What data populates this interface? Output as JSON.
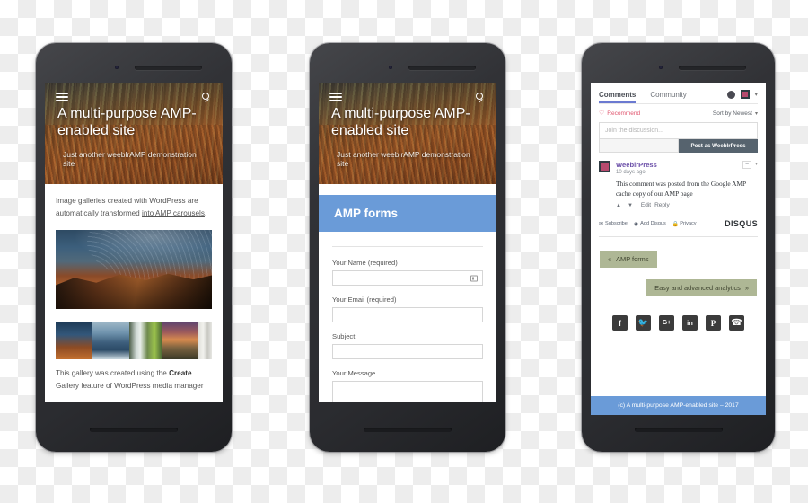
{
  "scene": {
    "background": "transparency-checkerboard",
    "accent_blue": "#6a9bd8",
    "nav_button_green": "#aeb795"
  },
  "site": {
    "title": "A multi-purpose AMP-enabled site",
    "tagline": "Just another weeblrAMP demonstration site",
    "footer": "(c) A multi-purpose AMP-enabled site – 2017",
    "menu_icon": "hamburger-icon",
    "search_icon": "search-icon"
  },
  "phone1": {
    "article": {
      "paragraph_1_a": "Image galleries created with WordPress are automatically transformed ",
      "paragraph_1_link": "into AMP carousels",
      "paragraph_1_b": ".",
      "caption_a": "This gallery was created using the ",
      "caption_bold": "Create",
      "caption_cut": "Gallery feature of WordPress media manager"
    },
    "gallery": {
      "hero_alt": "star-trails-over-red-rock-mesa",
      "thumbnails": [
        "star-trails-mesa-thumb",
        "iceland-mountain-reflection-thumb",
        "waterfall-green-hills-thumb",
        "sunset-vineyard-rows-thumb",
        "white-column-thumb"
      ]
    }
  },
  "phone2": {
    "page_title": "AMP forms",
    "fields": [
      {
        "label": "Your Name (required)",
        "value": "",
        "type": "text",
        "icon": "input-badge-icon"
      },
      {
        "label": "Your Email (required)",
        "value": "",
        "type": "email",
        "icon": ""
      },
      {
        "label": "Subject",
        "value": "",
        "type": "text",
        "icon": ""
      },
      {
        "label": "Your Message",
        "value": "",
        "type": "textarea",
        "icon": ""
      }
    ]
  },
  "phone3": {
    "disqus": {
      "tabs": [
        {
          "label": "Comments",
          "active": true
        },
        {
          "label": "Community",
          "active": false
        }
      ],
      "recommend_label": "Recommend",
      "recommend_icon": "heart-icon",
      "sort_label": "Sort by Newest",
      "sort_caret": "▾",
      "composer_placeholder": "Join the discussion...",
      "post_button": "Post as WeeblrPress",
      "comment": {
        "author": "WeeblrPress",
        "time": "10 days ago",
        "text": "This comment was posted from the Google AMP cache copy of our AMP page",
        "actions": [
          "Edit",
          "Reply"
        ],
        "upvote_icon": "chevron-up-icon",
        "downvote_icon": "chevron-down-icon",
        "collapse_label": "−",
        "more_label": "▾"
      },
      "footer_links": [
        {
          "label": "Subscribe",
          "icon": "envelope-icon"
        },
        {
          "label": "Add Disqus",
          "icon": "disqus-d-icon"
        },
        {
          "label": "Privacy",
          "icon": "lock-icon"
        }
      ],
      "brand": "DISQUS"
    },
    "pagination": {
      "prev": {
        "arrow": "«",
        "label": "AMP forms"
      },
      "next": {
        "label": "Easy and advanced analytics",
        "arrow": "»"
      }
    },
    "social": [
      {
        "name": "facebook-icon",
        "glyph": "f"
      },
      {
        "name": "twitter-icon",
        "glyph": ""
      },
      {
        "name": "google-plus-icon",
        "glyph": "G+"
      },
      {
        "name": "linkedin-icon",
        "glyph": "in"
      },
      {
        "name": "pinterest-icon",
        "glyph": "P"
      },
      {
        "name": "whatsapp-icon",
        "glyph": ""
      }
    ]
  }
}
